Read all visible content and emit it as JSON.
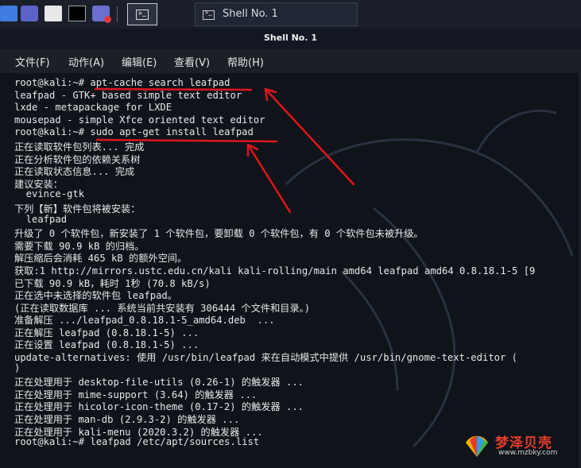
{
  "panel": {
    "icons": [
      "kali-menu-icon",
      "terminal-icon",
      "file-manager-icon",
      "terminal-icon",
      "screen-recorder-icon"
    ],
    "tab_label": "Shell No. 1"
  },
  "window": {
    "title": "Shell No. 1",
    "menu": [
      "文件(F)",
      "动作(A)",
      "编辑(E)",
      "查看(V)",
      "帮助(H)"
    ]
  },
  "terminal": {
    "lines": [
      "root@kali:~# apt-cache search leafpad",
      "leafpad - GTK+ based simple text editor",
      "lxde - metapackage for LXDE",
      "mousepad - simple Xfce oriented text editor",
      "root@kali:~# sudo apt-get install leafpad",
      "正在读取软件包列表... 完成",
      "正在分析软件包的依赖关系树",
      "正在读取状态信息... 完成",
      "建议安装：",
      "  evince-gtk",
      "下列【新】软件包将被安装：",
      "  leafpad",
      "升级了 0 个软件包，新安装了 1 个软件包，要卸载 0 个软件包，有 0 个软件包未被升级。",
      "需要下载 90.9 kB 的归档。",
      "解压缩后会消耗 465 kB 的额外空间。",
      "获取:1 http://mirrors.ustc.edu.cn/kali kali-rolling/main amd64 leafpad amd64 0.8.18.1-5 [9",
      "已下载 90.9 kB，耗时 1秒 (70.8 kB/s)",
      "正在选中未选择的软件包 leafpad。",
      "(正在读取数据库 ... 系统当前共安装有 306444 个文件和目录。)",
      "准备解压 .../leafpad_0.8.18.1-5_amd64.deb  ...",
      "正在解压 leafpad (0.8.18.1-5) ...",
      "正在设置 leafpad (0.8.18.1-5) ...",
      "update-alternatives: 使用 /usr/bin/leafpad 来在自动模式中提供 /usr/bin/gnome-text-editor (",
      ")",
      "正在处理用于 desktop-file-utils (0.26-1) 的触发器 ...",
      "正在处理用于 mime-support (3.64) 的触发器 ...",
      "正在处理用于 hicolor-icon-theme (0.17-2) 的触发器 ...",
      "正在处理用于 man-db (2.9.3-2) 的触发器 ...",
      "正在处理用于 kali-menu (2020.3.2) 的触发器 ...",
      "root@kali:~# leafpad /etc/apt/sources.list"
    ]
  },
  "watermark": {
    "name": "梦泽贝壳",
    "url": "www.mzbky.com"
  },
  "colors": {
    "annotation": "#e0161b",
    "watermark_text": "#e53b2c"
  }
}
